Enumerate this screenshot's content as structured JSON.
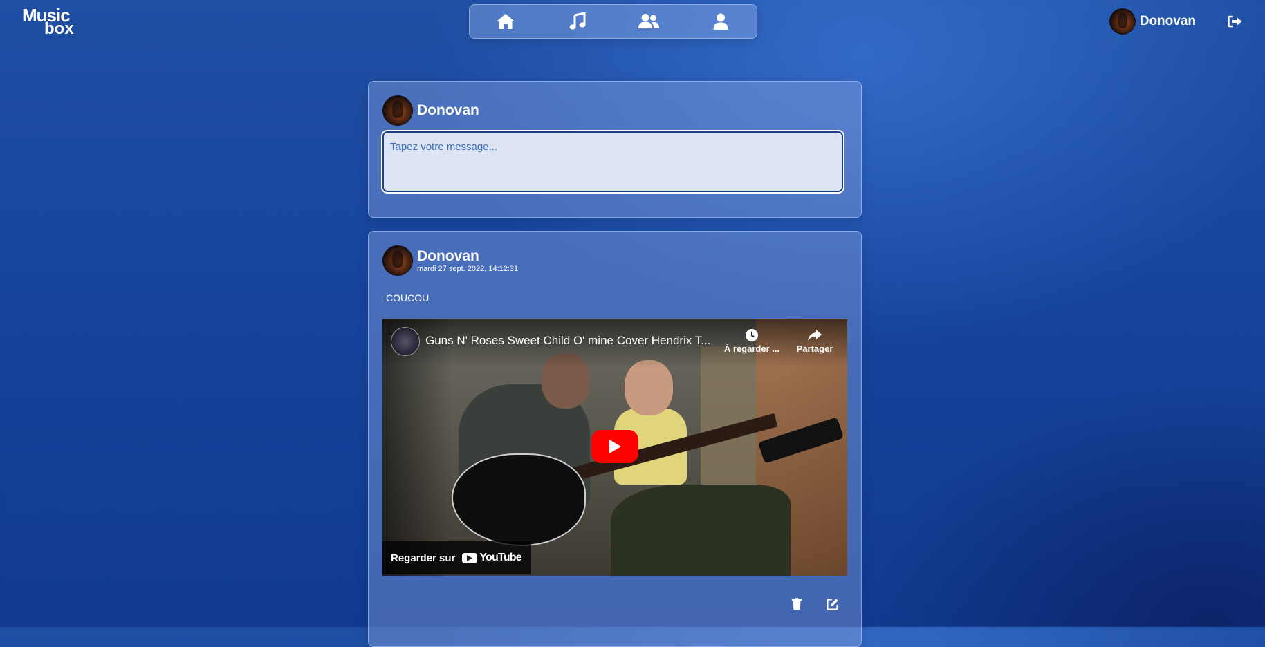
{
  "app": {
    "logo_line1": "Music",
    "logo_line2": "box"
  },
  "nav": {
    "items": [
      {
        "icon": "home-icon"
      },
      {
        "icon": "music-note-icon"
      },
      {
        "icon": "users-icon"
      },
      {
        "icon": "user-icon"
      }
    ]
  },
  "header": {
    "user_name": "Donovan",
    "logout_icon": "logout-icon"
  },
  "composer": {
    "user_name": "Donovan",
    "placeholder": "Tapez votre message...",
    "value": ""
  },
  "post": {
    "user_name": "Donovan",
    "date": "mardi 27 sept. 2022, 14:12:31",
    "text": "COUCOU",
    "video": {
      "title": "Guns N' Roses Sweet Child O' mine Cover Hendrix T...",
      "watch_later_label": "À regarder ...",
      "share_label": "Partager",
      "watch_on_label": "Regarder sur",
      "youtube_label": "YouTube"
    },
    "actions": {
      "delete_icon": "trash-icon",
      "edit_icon": "edit-icon"
    }
  },
  "colors": {
    "accent": "#1d3d86",
    "input_bg": "#dce3f2",
    "play_red": "#ff0000"
  }
}
